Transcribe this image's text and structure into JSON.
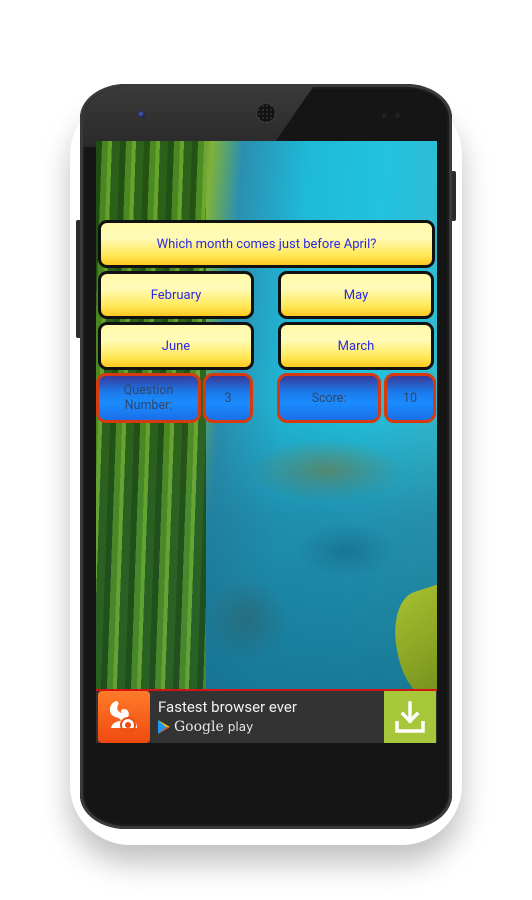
{
  "quiz": {
    "question": "Which month comes just before April?",
    "answers": [
      "February",
      "May",
      "June",
      "March"
    ],
    "question_number_label": "Question Number:",
    "question_number_value": "3",
    "score_label": "Score:",
    "score_value": "10"
  },
  "ad": {
    "title": "Fastest browser ever",
    "store_brand": "Google",
    "store_suffix": "play",
    "logo_icon": "uc-browser-squirrel-icon",
    "action_icon": "download-icon",
    "colors": {
      "border": "#d11515",
      "download_bg": "#a7c73a",
      "logo_bg": "#f46a1e"
    }
  },
  "theme": {
    "button_text": "#2a2ae6",
    "yellow_button": "#ffe95a",
    "stat_box": "#1a8cff",
    "stat_border": "#d83a10"
  }
}
